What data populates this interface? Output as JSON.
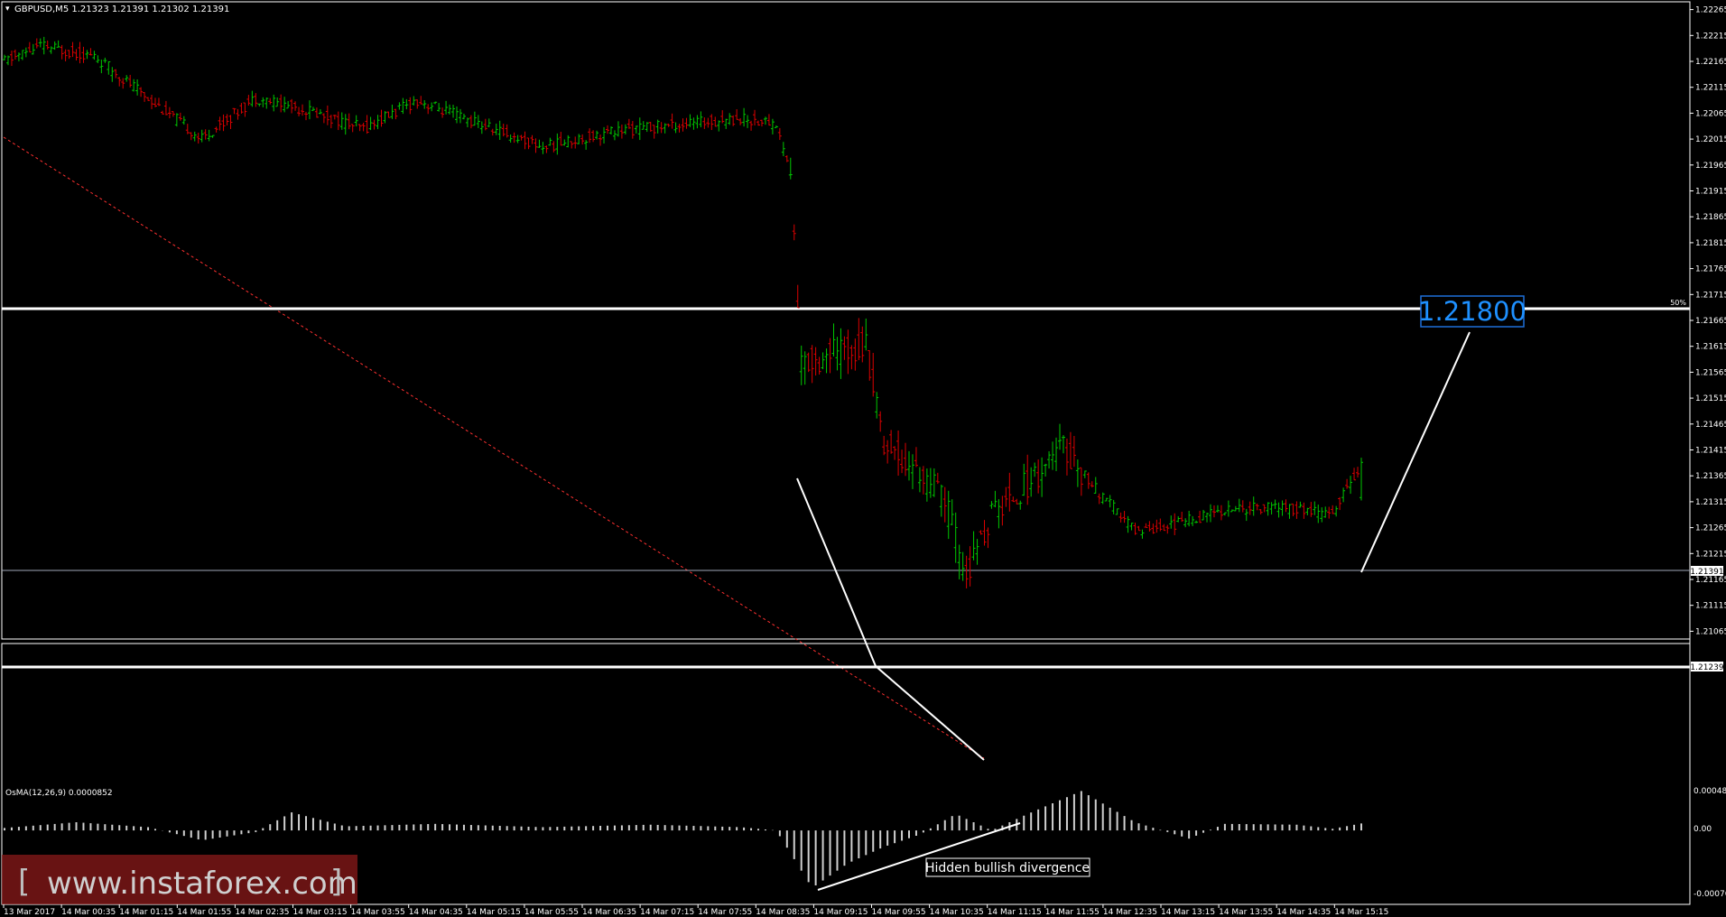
{
  "header": {
    "symbol_line": "GBPUSD,M5  1.21323 1.21391 1.21302 1.21391"
  },
  "indicator": {
    "label": "OsMA(12,26,9) 0.0000852",
    "axis_top": "0.000485",
    "axis_zero": "0.00",
    "axis_bottom": "-0.000769"
  },
  "annotations": {
    "target_level": "1.21800",
    "fifty_pct": "50%",
    "divergence": "Hidden bullish divergence",
    "current_price": "1.21391",
    "support_price": "1.21239"
  },
  "watermark": {
    "text": "www.instaforex.com",
    "bracket_left": "[",
    "bracket_right": "]"
  },
  "colors": {
    "background": "#000000",
    "bull": "#00c800",
    "bear": "#dc0000",
    "grid": "#ffffff",
    "target_box": "#1e6fd9",
    "trendline": "#ff3030",
    "watermark_bg": "#8b1a1a"
  },
  "chart_data": [
    {
      "type": "candlestick",
      "title": "GBPUSD,M5",
      "y_ticks": [
        "1.22265",
        "1.22215",
        "1.22165",
        "1.22115",
        "1.22065",
        "1.22015",
        "1.21965",
        "1.21915",
        "1.21865",
        "1.21815",
        "1.21765",
        "1.21715",
        "1.21665",
        "1.21615",
        "1.21565",
        "1.21515",
        "1.21465",
        "1.21415",
        "1.21365",
        "1.21315",
        "1.21265",
        "1.21215",
        "1.21165",
        "1.21115",
        "1.21065"
      ],
      "ylim": [
        1.2105,
        1.2228
      ],
      "x_ticks": [
        "13 Mar 2017",
        "14 Mar 00:35",
        "14 Mar 01:15",
        "14 Mar 01:55",
        "14 Mar 02:35",
        "14 Mar 03:15",
        "14 Mar 03:55",
        "14 Mar 04:35",
        "14 Mar 05:15",
        "14 Mar 05:55",
        "14 Mar 06:35",
        "14 Mar 07:15",
        "14 Mar 07:55",
        "14 Mar 08:35",
        "14 Mar 09:15",
        "14 Mar 09:55",
        "14 Mar 10:35",
        "14 Mar 11:15",
        "14 Mar 11:55",
        "14 Mar 12:35",
        "14 Mar 13:15",
        "14 Mar 13:55",
        "14 Mar 14:35",
        "14 Mar 15:15"
      ],
      "horizontal_levels": [
        1.218,
        1.21239
      ],
      "current_price": 1.21391,
      "target": 1.218,
      "last_bar": {
        "open": 1.21323,
        "high": 1.21391,
        "low": 1.21302,
        "close": 1.21391
      }
    },
    {
      "type": "bar",
      "title": "OsMA(12,26,9)",
      "ylim": [
        -0.000769,
        0.000485
      ],
      "last_value": 8.52e-05
    }
  ]
}
